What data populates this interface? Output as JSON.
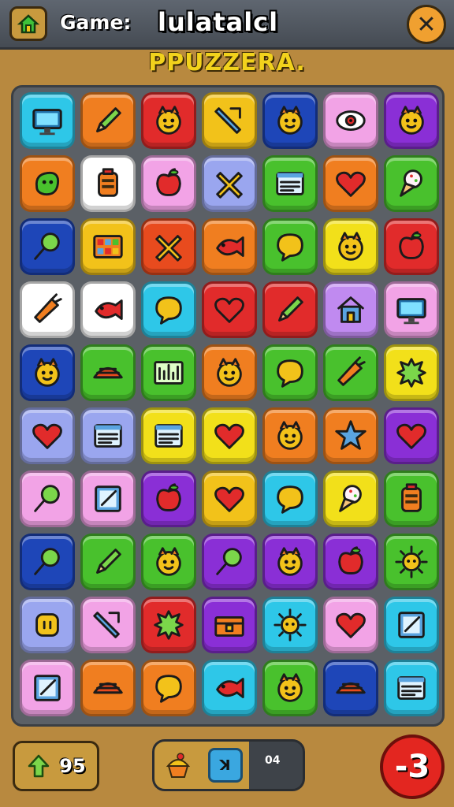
{
  "header": {
    "game_label": "Game:",
    "title": "lulatalcl",
    "close_symbol": "✕"
  },
  "subtitle": "PPUZZERA.",
  "tiles": [
    {
      "bg": "#2ec7e8",
      "icon": "monitor"
    },
    {
      "bg": "#f07e20",
      "icon": "pencil"
    },
    {
      "bg": "#e12b2b",
      "icon": "critter"
    },
    {
      "bg": "#f2c21a",
      "icon": "tool"
    },
    {
      "bg": "#1e46b8",
      "icon": "critter"
    },
    {
      "bg": "#f2a3e6",
      "icon": "eye"
    },
    {
      "bg": "#8a2fd6",
      "icon": "critter"
    },
    {
      "bg": "#f07e20",
      "icon": "blob"
    },
    {
      "bg": "#ffffff",
      "icon": "jar"
    },
    {
      "bg": "#f2a3e6",
      "icon": "apple"
    },
    {
      "bg": "#9aa6ef",
      "icon": "cross"
    },
    {
      "bg": "#49c12d",
      "icon": "note"
    },
    {
      "bg": "#f07e20",
      "icon": "heart"
    },
    {
      "bg": "#49c12d",
      "icon": "icecream"
    },
    {
      "bg": "#1e46b8",
      "icon": "magnifier"
    },
    {
      "bg": "#f2c21a",
      "icon": "grid"
    },
    {
      "bg": "#e84b1e",
      "icon": "cross"
    },
    {
      "bg": "#f07e20",
      "icon": "fish"
    },
    {
      "bg": "#49c12d",
      "icon": "bubble"
    },
    {
      "bg": "#f2e01a",
      "icon": "critter"
    },
    {
      "bg": "#e12b2b",
      "icon": "apple"
    },
    {
      "bg": "#ffffff",
      "icon": "carrot"
    },
    {
      "bg": "#ffffff",
      "icon": "fish"
    },
    {
      "bg": "#2ec7e8",
      "icon": "bubble"
    },
    {
      "bg": "#e12b2b",
      "icon": "heart"
    },
    {
      "bg": "#e12b2b",
      "icon": "pencil"
    },
    {
      "bg": "#c08af0",
      "icon": "house"
    },
    {
      "bg": "#f2a3e6",
      "icon": "monitor"
    },
    {
      "bg": "#1e46b8",
      "icon": "critter"
    },
    {
      "bg": "#49c12d",
      "icon": "ball"
    },
    {
      "bg": "#49c12d",
      "icon": "chart"
    },
    {
      "bg": "#f07e20",
      "icon": "critter"
    },
    {
      "bg": "#49c12d",
      "icon": "bubble"
    },
    {
      "bg": "#49c12d",
      "icon": "carrot"
    },
    {
      "bg": "#f2e01a",
      "icon": "splat"
    },
    {
      "bg": "#9aa6ef",
      "icon": "heart"
    },
    {
      "bg": "#9aa6ef",
      "icon": "note"
    },
    {
      "bg": "#f2e01a",
      "icon": "note"
    },
    {
      "bg": "#f2e01a",
      "icon": "heart"
    },
    {
      "bg": "#f07e20",
      "icon": "critter"
    },
    {
      "bg": "#f07e20",
      "icon": "star"
    },
    {
      "bg": "#8a2fd6",
      "icon": "heart"
    },
    {
      "bg": "#f2a3e6",
      "icon": "magnifier"
    },
    {
      "bg": "#f2a3e6",
      "icon": "frame"
    },
    {
      "bg": "#8a2fd6",
      "icon": "apple"
    },
    {
      "bg": "#f2c21a",
      "icon": "heart"
    },
    {
      "bg": "#2ec7e8",
      "icon": "bubble"
    },
    {
      "bg": "#f2e01a",
      "icon": "icecream"
    },
    {
      "bg": "#49c12d",
      "icon": "jar"
    },
    {
      "bg": "#1e46b8",
      "icon": "magnifier"
    },
    {
      "bg": "#49c12d",
      "icon": "pencil"
    },
    {
      "bg": "#49c12d",
      "icon": "critter"
    },
    {
      "bg": "#8a2fd6",
      "icon": "magnifier"
    },
    {
      "bg": "#8a2fd6",
      "icon": "critter"
    },
    {
      "bg": "#8a2fd6",
      "icon": "apple"
    },
    {
      "bg": "#49c12d",
      "icon": "sun"
    },
    {
      "bg": "#9aa6ef",
      "icon": "face"
    },
    {
      "bg": "#f2a3e6",
      "icon": "tool"
    },
    {
      "bg": "#e12b2b",
      "icon": "splat"
    },
    {
      "bg": "#8a2fd6",
      "icon": "chest"
    },
    {
      "bg": "#2ec7e8",
      "icon": "sun"
    },
    {
      "bg": "#f2a3e6",
      "icon": "heart"
    },
    {
      "bg": "#2ec7e8",
      "icon": "frame"
    },
    {
      "bg": "#f2a3e6",
      "icon": "frame"
    },
    {
      "bg": "#f07e20",
      "icon": "ball"
    },
    {
      "bg": "#f07e20",
      "icon": "bubble"
    },
    {
      "bg": "#2ec7e8",
      "icon": "fish"
    },
    {
      "bg": "#49c12d",
      "icon": "critter"
    },
    {
      "bg": "#1e46b8",
      "icon": "ball"
    },
    {
      "bg": "#2ec7e8",
      "icon": "note"
    }
  ],
  "footer": {
    "score": "95",
    "boost_label": "ꓘ",
    "boost_count": "04",
    "moves": "-3"
  },
  "colors": {
    "background": "#b8893f",
    "board": "#5b6066",
    "topbar": "#4f555d",
    "accent_yellow": "#f2d21c",
    "moves_red": "#e32620"
  }
}
